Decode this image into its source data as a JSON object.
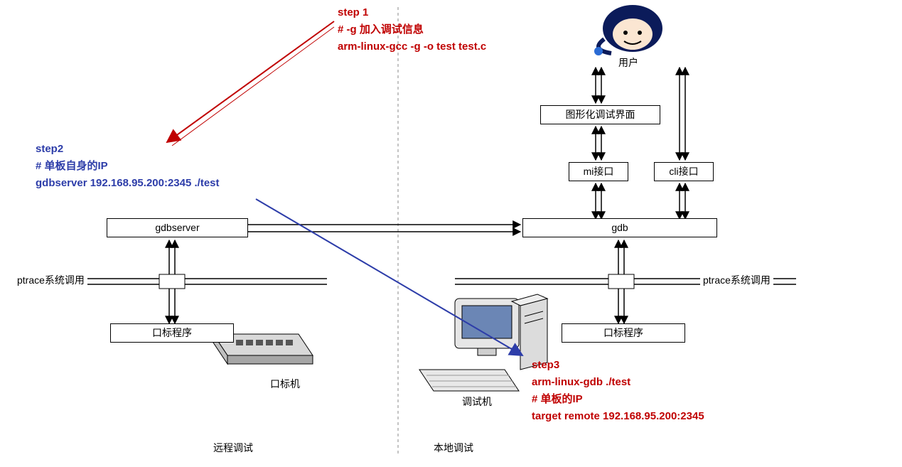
{
  "step1": {
    "title": "step 1",
    "line2": "# -g 加入调试信息",
    "line3": "arm-linux-gcc -g -o test test.c"
  },
  "step2": {
    "title": "step2",
    "line2": "# 单板自身的IP",
    "line3": "gdbserver 192.168.95.200:2345  ./test"
  },
  "step3": {
    "title": "step3",
    "line2": "arm-linux-gdb ./test",
    "line3": "# 单板的IP",
    "line4": "target  remote 192.168.95.200:2345"
  },
  "nodes": {
    "user": "用户",
    "gui": "图形化调试界面",
    "mi": "mi接口",
    "cli": "cli接口",
    "gdb": "gdb",
    "gdbserver": "gdbserver",
    "target_prog_left": "口标程序",
    "target_prog_right": "口标程序",
    "ptrace_left": "ptrace系统调用",
    "ptrace_right": "ptrace系统调用",
    "target_machine": "口标机",
    "debug_machine": "调试机",
    "remote_debug": "远程调试",
    "local_debug": "本地调试"
  }
}
